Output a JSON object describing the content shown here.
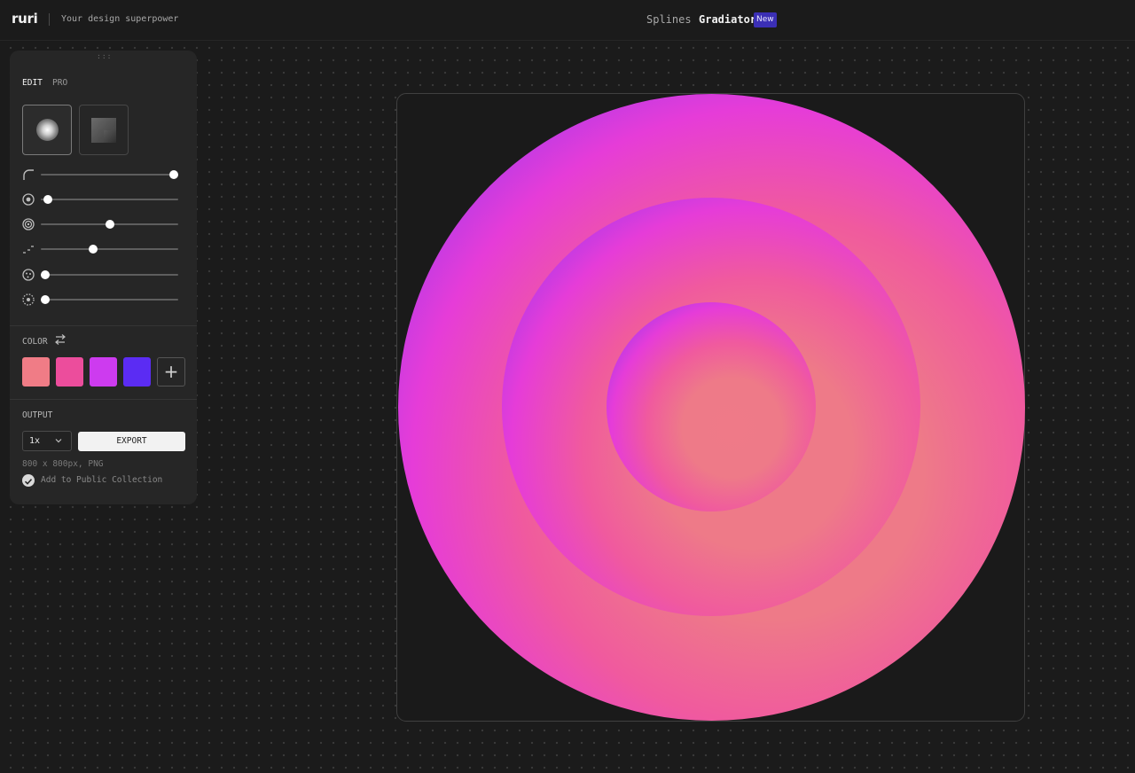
{
  "header": {
    "logo": "ruri",
    "tagline": "Your design superpower",
    "nav": [
      {
        "label": "Splines"
      },
      {
        "label": "Gradiator",
        "badge": "New"
      }
    ]
  },
  "panel": {
    "grip": ":::",
    "tabs": [
      {
        "label": "EDIT",
        "active": true
      },
      {
        "label": "PRO",
        "active": false
      }
    ],
    "shapes": [
      {
        "name": "radial-shape",
        "selected": true
      },
      {
        "name": "linear-shape",
        "selected": false
      }
    ],
    "sliders": [
      {
        "icon": "corner-radius-icon",
        "value": 1.0
      },
      {
        "icon": "target-icon",
        "value": 0.05
      },
      {
        "icon": "spiral-icon",
        "value": 0.52
      },
      {
        "icon": "gradient-steps-icon",
        "value": 0.39
      },
      {
        "icon": "noise-icon",
        "value": 0.03
      },
      {
        "icon": "dotted-circle-icon",
        "value": 0.03
      }
    ],
    "color": {
      "label": "COLOR",
      "swatches": [
        "#f07c86",
        "#ec4d9c",
        "#cd3bef",
        "#5b2cf3"
      ],
      "add_label": "+"
    },
    "output": {
      "label": "OUTPUT",
      "scale": "1x",
      "export_label": "EXPORT",
      "info": "800 x 800px, PNG",
      "collection_label": "Add to Public Collection",
      "collection_checked": true
    }
  },
  "canvas": {
    "rings": 3,
    "colors": [
      "#ef7a88",
      "#f05a9e",
      "#e63cd8",
      "#6a2bf2"
    ]
  }
}
